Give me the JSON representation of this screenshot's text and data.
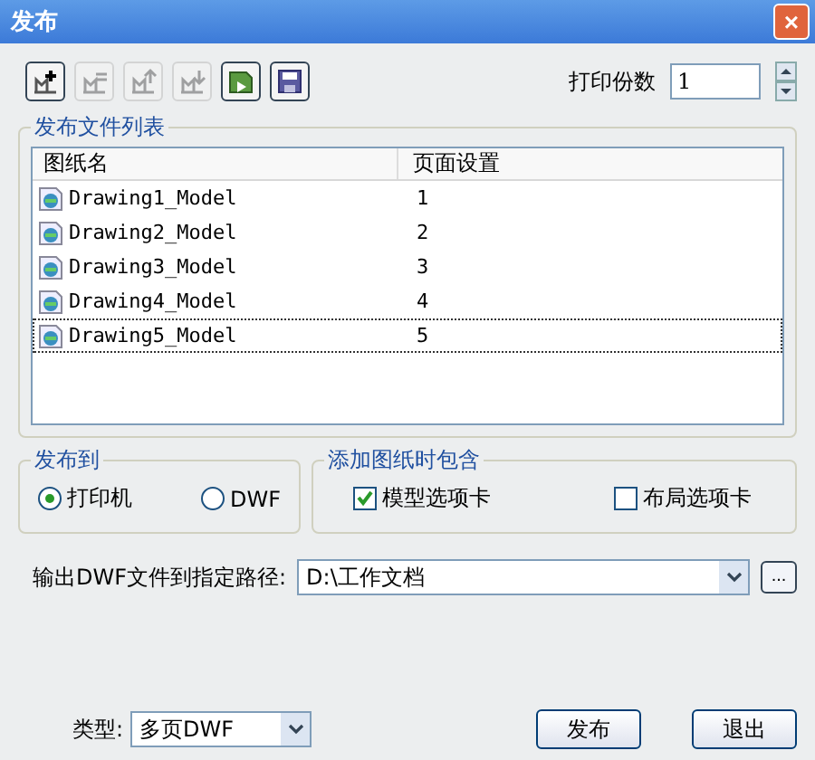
{
  "window": {
    "title": "发布",
    "close": "×"
  },
  "toolbar": [
    {
      "kind": "add",
      "disabled": false
    },
    {
      "kind": "remove",
      "disabled": true
    },
    {
      "kind": "up",
      "disabled": true
    },
    {
      "kind": "down",
      "disabled": true
    },
    {
      "kind": "preview",
      "disabled": false
    },
    {
      "kind": "save",
      "disabled": false
    }
  ],
  "copies": {
    "label": "打印份数",
    "value": "1"
  },
  "file_list": {
    "title": "发布文件列表",
    "columns": [
      "图纸名",
      "页面设置"
    ],
    "rows": [
      {
        "name": "Drawing1_Model",
        "setup": "1",
        "selected": false
      },
      {
        "name": "Drawing2_Model",
        "setup": "2",
        "selected": false
      },
      {
        "name": "Drawing3_Model",
        "setup": "3",
        "selected": false
      },
      {
        "name": "Drawing4_Model",
        "setup": "4",
        "selected": false
      },
      {
        "name": "Drawing5_Model",
        "setup": "5",
        "selected": true
      }
    ]
  },
  "publish_to": {
    "title": "发布到",
    "options": [
      {
        "label": "打印机",
        "selected": true
      },
      {
        "label": "DWF",
        "selected": false
      }
    ]
  },
  "include": {
    "title": "添加图纸时包含",
    "options": [
      {
        "label": "模型选项卡",
        "checked": true
      },
      {
        "label": "布局选项卡",
        "checked": false
      }
    ]
  },
  "output_path": {
    "label": "输出DWF文件到指定路径:",
    "value": "D:\\工作文档",
    "browse": "..."
  },
  "type": {
    "label": "类型:",
    "value": "多页DWF"
  },
  "buttons": [
    "发布",
    "退出"
  ]
}
